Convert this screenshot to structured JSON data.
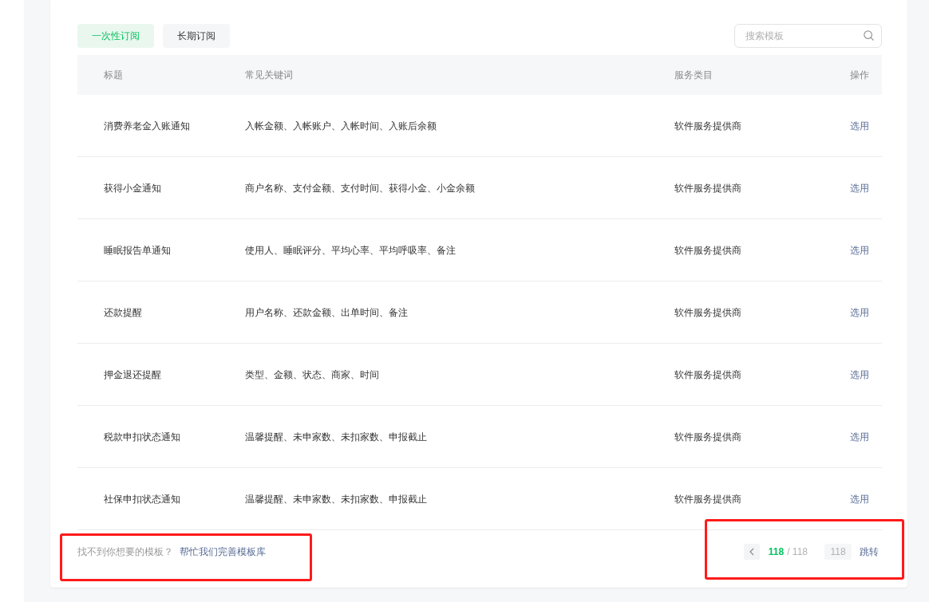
{
  "tabs": [
    {
      "label": "一次性订阅",
      "selected": true
    },
    {
      "label": "长期订阅",
      "selected": false
    }
  ],
  "search": {
    "placeholder": "搜索模板"
  },
  "table": {
    "columns": [
      "标题",
      "常见关键词",
      "服务类目",
      "操作"
    ],
    "rows": [
      {
        "title": "消费养老金入账通知",
        "keywords": "入帐金额、入帐账户、入帐时间、入账后余额",
        "category": "软件服务提供商",
        "action": "选用"
      },
      {
        "title": "获得小金通知",
        "keywords": "商户名称、支付金额、支付时间、获得小金、小金余额",
        "category": "软件服务提供商",
        "action": "选用"
      },
      {
        "title": "睡眠报告单通知",
        "keywords": "使用人、睡眠评分、平均心率、平均呼吸率、备注",
        "category": "软件服务提供商",
        "action": "选用"
      },
      {
        "title": "还款提醒",
        "keywords": "用户名称、还款金额、出单时间、备注",
        "category": "软件服务提供商",
        "action": "选用"
      },
      {
        "title": "押金退还提醒",
        "keywords": "类型、金额、状态、商家、时间",
        "category": "软件服务提供商",
        "action": "选用"
      },
      {
        "title": "税款申扣状态通知",
        "keywords": "温馨提醒、未申家数、未扣家数、申报截止",
        "category": "软件服务提供商",
        "action": "选用"
      },
      {
        "title": "社保申扣状态通知",
        "keywords": "温馨提醒、未申家数、未扣家数、申报截止",
        "category": "软件服务提供商",
        "action": "选用"
      }
    ]
  },
  "footer": {
    "feedback": {
      "text": "找不到你想要的模板？",
      "link": "帮忙我们完善模板库",
      "highlighted": true
    },
    "pagination": {
      "current": "118",
      "total": "/ 118",
      "jump_value": "118",
      "jump_button": "跳转",
      "highlighted": true
    }
  }
}
